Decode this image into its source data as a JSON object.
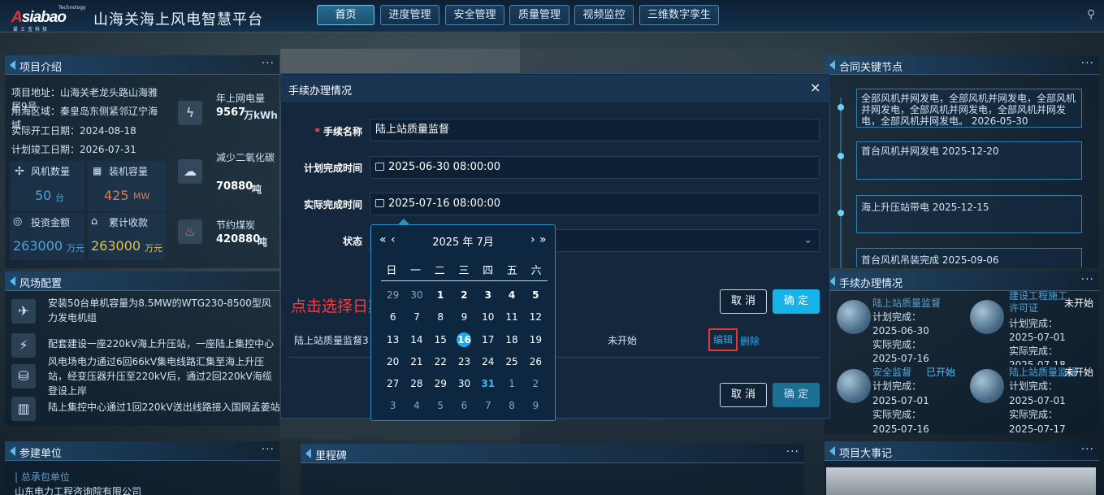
{
  "header": {
    "logo": {
      "tech": "Technology",
      "brand_a": "A",
      "brand_rest": "siabao",
      "sub": "爱士宝科技"
    },
    "title": "山海关海上风电智慧平台",
    "nav": [
      {
        "label": "首页",
        "active": true
      },
      {
        "label": "进度管理"
      },
      {
        "label": "安全管理"
      },
      {
        "label": "质量管理"
      },
      {
        "label": "视频监控"
      },
      {
        "label": "三维数字孪生"
      }
    ]
  },
  "project_intro": {
    "title": "项目介绍",
    "more": "···",
    "address": "项目地址：山海关老龙头路山海雅居9号",
    "sea_area": "用海区域：秦皇岛东侧紧邻辽宁海域",
    "start_date": "实际开工日期：2024-08-18",
    "finish_date": "计划竣工日期：2026-07-31",
    "stats": [
      {
        "label": "风机数量",
        "value": "50",
        "unit": "台"
      },
      {
        "label": "装机容量",
        "value": "425",
        "unit": "MW"
      },
      {
        "label": "投资金额",
        "value": "263000",
        "unit": "万元"
      },
      {
        "label": "累计收款",
        "value": "263000",
        "unit": "万元"
      }
    ],
    "side_stats": [
      {
        "label": "年上网电量",
        "value": "9567",
        "unit": "万kWh"
      },
      {
        "label": "减少二氧化碳",
        "value": "70880",
        "unit": "吨"
      },
      {
        "label": "节约煤炭",
        "value": "420880",
        "unit": "吨"
      }
    ]
  },
  "wind_config": {
    "title": "风场配置",
    "more": "···",
    "items": [
      "安装50台单机容量为8.5MW的WTG230-8500型风力发电机组",
      "配套建设一座220kV海上升压站，一座陆上集控中心",
      "风电场电力通过6回66kV集电线路汇集至海上升压站，经变压器升压至220kV后，通过2回220kV海缆登设上岸",
      "陆上集控中心通过1回220kV送出线路接入国网孟姜站"
    ]
  },
  "participants": {
    "title": "参建单位",
    "more": "···",
    "label": "总承包单位",
    "company": "山东电力工程咨询院有限公司"
  },
  "milestone": {
    "title": "里程碑",
    "more": "···"
  },
  "contract_nodes": {
    "title": "合同关键节点",
    "more": "···",
    "items": [
      "全部风机并网发电，全部风机并网发电，全部风机并网发电，全部风机并网发电，全部风机并网发电，全部风机并网发电。 2026-05-30",
      "首台风机并网发电 2025-12-20",
      "海上升压站带电 2025-12-15",
      "首台风机吊装完成 2025-09-06"
    ]
  },
  "procedures_panel": {
    "title": "手续办理情况",
    "more": "···",
    "cards": [
      {
        "name": "陆上站质量监督",
        "status": "",
        "plan": "计划完成：2025-06-30",
        "actual": "实际完成：2025-07-16"
      },
      {
        "name": "建设工程施工许可证",
        "status": "未开始",
        "plan": "计划完成：2025-07-01",
        "actual": "实际完成：2025-07-18"
      },
      {
        "name": "安全监督",
        "status": "已开始",
        "plan": "计划完成：2025-07-01",
        "actual": "实际完成：2025-07-16"
      },
      {
        "name": "陆上站质量监督",
        "status": "未开始",
        "plan": "计划完成：2025-07-01",
        "actual": "实际完成：2025-07-17"
      }
    ]
  },
  "events": {
    "title": "项目大事记",
    "more": "···"
  },
  "modal": {
    "title": "手续办理情况",
    "close": "×",
    "fields": {
      "name_label": "手续名称",
      "name_value": "陆上站质量监督",
      "plan_label": "计划完成时间",
      "plan_value": "2025-06-30 08:00:00",
      "actual_label": "实际完成时间",
      "actual_value": "2025-07-16 08:00:00",
      "status_label": "状态"
    },
    "cancel": "取 消",
    "ok": "确 定",
    "hint": "点击选择日期无响应",
    "row": {
      "name": "陆上站质量监督3",
      "status": "未开始",
      "edit": "编辑",
      "delete": "删除"
    }
  },
  "datepicker": {
    "header": "2025 年  7月",
    "prev_year": "«",
    "prev_month": "‹",
    "next_month": "›",
    "next_year": "»",
    "weekdays": [
      "日",
      "一",
      "二",
      "三",
      "四",
      "五",
      "六"
    ],
    "weeks": [
      [
        "29",
        "30",
        "1",
        "2",
        "3",
        "4",
        "5"
      ],
      [
        "6",
        "7",
        "8",
        "9",
        "10",
        "11",
        "12"
      ],
      [
        "13",
        "14",
        "15",
        "16",
        "17",
        "18",
        "19"
      ],
      [
        "20",
        "21",
        "22",
        "23",
        "24",
        "25",
        "26"
      ],
      [
        "27",
        "28",
        "29",
        "30",
        "31",
        "1",
        "2"
      ],
      [
        "3",
        "4",
        "5",
        "6",
        "7",
        "8",
        "9"
      ]
    ],
    "selected": "16",
    "today": "31"
  }
}
